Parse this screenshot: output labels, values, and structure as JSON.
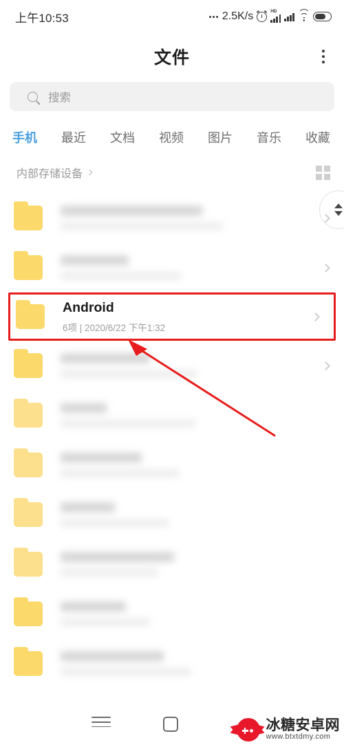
{
  "status_bar": {
    "time": "上午10:53",
    "network_speed": "2.5K/s",
    "icons": [
      "three-dots-icon",
      "alarm-clock-icon",
      "hd-signal-icon",
      "signal-icon",
      "wifi-icon",
      "battery-icon"
    ]
  },
  "app_bar": {
    "title": "文件",
    "overflow_icon": "more-vertical-icon"
  },
  "search": {
    "placeholder": "搜索",
    "value": "",
    "icon": "search-icon"
  },
  "tabs": [
    {
      "label": "手机",
      "active": true
    },
    {
      "label": "最近",
      "active": false
    },
    {
      "label": "文档",
      "active": false
    },
    {
      "label": "视频",
      "active": false
    },
    {
      "label": "图片",
      "active": false
    },
    {
      "label": "音乐",
      "active": false
    },
    {
      "label": "收藏",
      "active": false
    }
  ],
  "breadcrumb": {
    "label": "内部存储设备",
    "chevron_icon": "chevron-right-icon",
    "view_toggle_icon": "grid-view-icon"
  },
  "scrollbar": {
    "up_icon": "triangle-up-icon",
    "down_icon": "triangle-down-icon"
  },
  "file_list": {
    "rows": [
      {
        "name": "",
        "meta": "",
        "redacted": true,
        "highlighted": false,
        "folder_icon": "folder-icon",
        "chevron": true
      },
      {
        "name": "",
        "meta": "",
        "redacted": true,
        "highlighted": false,
        "folder_icon": "folder-icon",
        "chevron": true
      },
      {
        "name": "Android",
        "meta": "6项 | 2020/6/22 下午1:32",
        "redacted": false,
        "highlighted": true,
        "folder_icon": "folder-icon",
        "chevron": true
      },
      {
        "name": "",
        "meta": "",
        "redacted": true,
        "highlighted": false,
        "folder_icon": "folder-icon",
        "chevron": true
      },
      {
        "name": "",
        "meta": "",
        "redacted": true,
        "highlighted": false,
        "folder_icon": "folder-icon",
        "chevron": false
      },
      {
        "name": "",
        "meta": "",
        "redacted": true,
        "highlighted": false,
        "folder_icon": "folder-icon",
        "chevron": false
      },
      {
        "name": "",
        "meta": "",
        "redacted": true,
        "highlighted": false,
        "folder_icon": "folder-icon",
        "chevron": false
      },
      {
        "name": "",
        "meta": "",
        "redacted": true,
        "highlighted": false,
        "folder_icon": "folder-icon",
        "chevron": false
      },
      {
        "name": "",
        "meta": "",
        "redacted": true,
        "highlighted": false,
        "folder_icon": "folder-icon",
        "chevron": false
      },
      {
        "name": "",
        "meta": "",
        "redacted": true,
        "highlighted": false,
        "folder_icon": "folder-icon",
        "chevron": false
      }
    ]
  },
  "annotation": {
    "highlight_color": "#e81c1c",
    "arrow_color": "#e81c1c"
  },
  "nav_bar": {
    "recents_icon": "menu-icon",
    "home_icon": "square-icon",
    "back_icon": "chevron-left-icon"
  },
  "watermark": {
    "site_name": "冰糖安卓网",
    "url": "www.btxtdmy.com",
    "logo_icon": "candy-gamepad-icon",
    "brand_color": "#e8172a"
  },
  "theme": {
    "accent": "#4a9fe0",
    "folder": "#fcd96b",
    "search_bg": "#f1f1f1"
  }
}
